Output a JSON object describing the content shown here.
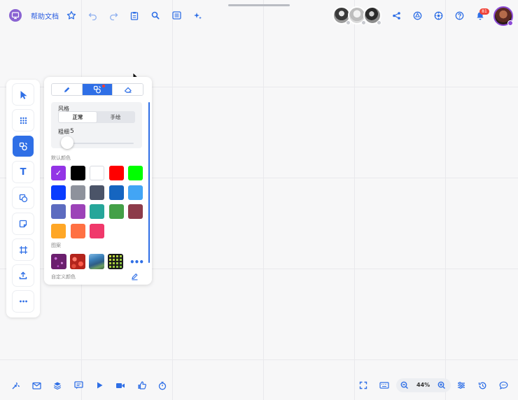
{
  "app": {
    "title": "帮助文档"
  },
  "topbar": {
    "notification_count": "81"
  },
  "left_toolbar": {
    "items": [
      {
        "name": "select",
        "icon": "cursor-icon",
        "active": false
      },
      {
        "name": "templates",
        "icon": "grid-icon",
        "active": false
      },
      {
        "name": "brush",
        "icon": "shapes-brush-icon",
        "active": true
      },
      {
        "name": "text",
        "icon": "text-icon",
        "glyph": "T",
        "active": false
      },
      {
        "name": "shape",
        "icon": "shape-icon",
        "active": false
      },
      {
        "name": "sticky-note",
        "icon": "sticky-note-icon",
        "active": false
      },
      {
        "name": "frame",
        "icon": "frame-icon",
        "active": false
      },
      {
        "name": "upload",
        "icon": "upload-icon",
        "active": false
      },
      {
        "name": "more",
        "icon": "more-icon",
        "glyph": "•••",
        "active": false
      }
    ]
  },
  "brush_panel": {
    "tabs": [
      {
        "icon": "pen-icon",
        "active": false
      },
      {
        "icon": "shape-brush-icon",
        "active": true
      },
      {
        "icon": "eraser-icon",
        "active": false
      }
    ],
    "style_label": "风格",
    "style_options": [
      "正常",
      "手绘"
    ],
    "style_selected": "正常",
    "thickness_label": "粗细",
    "thickness_value": "5",
    "thickness_level": 0.05,
    "default_colors_label": "默认颜色",
    "colors": [
      "#9334e6",
      "#000000",
      "#ffffff",
      "#ff0000",
      "#00ff00",
      "#0a3cff",
      "#8e929c",
      "#4b5468",
      "#1565c0",
      "#42a5f5",
      "#5c6bc0",
      "#9c42b8",
      "#26a69a",
      "#43a047",
      "#8d3b4a",
      "#ffa726",
      "#ff7043",
      "#f0386b"
    ],
    "selected_color": "#9334e6",
    "patterns_label": "图案",
    "patterns": [
      "purple-sparkle-pattern",
      "red-floral-pattern",
      "blue-landscape-pattern",
      "yellow-green-grid-pattern"
    ],
    "more_glyph": "•••",
    "custom_color_label": "自定义颜色"
  },
  "bottom_bar": {
    "zoom": "44%"
  },
  "colors": {
    "accent": "#2f6fe6",
    "badge": "#f0453a"
  }
}
